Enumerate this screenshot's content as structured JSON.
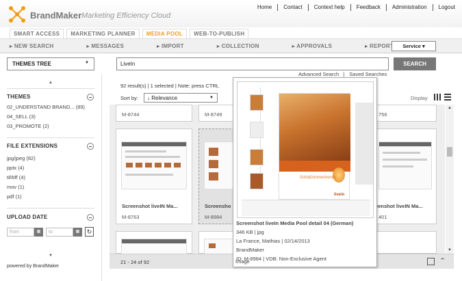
{
  "header": {
    "brand": "BrandMaker",
    "tagline": "Marketing Efficiency Cloud",
    "top_links": [
      "Home",
      "Contact",
      "Context help",
      "Feedback",
      "Administration",
      "Logout"
    ]
  },
  "module_tabs": [
    "SMART ACCESS",
    "MARKETING PLANNER",
    "MEDIA POOL",
    "WEB-TO-PUBLISH"
  ],
  "active_module": "MEDIA POOL",
  "subnav": [
    "NEW SEARCH",
    "MESSAGES",
    "IMPORT",
    "COLLECTION",
    "APPROVALS",
    "REPORTS"
  ],
  "service_label": "Service",
  "sidebar": {
    "tree_select": "THEMES TREE",
    "themes": {
      "title": "THEMES",
      "items": [
        "02_UNDERSTAND BRAND... (89)",
        "04_SELL (3)",
        "03_PROMOTE (2)"
      ]
    },
    "file_extensions": {
      "title": "FILE EXTENSIONS",
      "items": [
        "jpg/jpeg (82)",
        "pptx (4)",
        "tif/tiff (4)",
        "mov (1)",
        "pdf (1)"
      ]
    },
    "upload_date": {
      "title": "UPLOAD DATE",
      "from_placeholder": "from",
      "to_placeholder": "to"
    },
    "powered_by": "powered by BrandMaker"
  },
  "search": {
    "value": "LiveIn",
    "button": "SEARCH",
    "advanced_link": "Advanced Search",
    "saved_link": "Saved Searches"
  },
  "results": {
    "summary": "92 result(s) | 1 selected | Note: press CTRL",
    "sort_label": "Sort by:",
    "sort_value": "Relevance",
    "display_label": "Display",
    "top_row_ids": [
      "M-8744",
      "M-8749",
      "756"
    ],
    "cards": [
      {
        "name": "Screenshot liveIN Ma...",
        "id": "M-8763"
      },
      {
        "name": "Screensho",
        "id": "M-8984"
      },
      {
        "name": "creenshot liveIN Ma...",
        "id": "401"
      }
    ],
    "pager": "21 - 24 of 92"
  },
  "preview": {
    "title": "Screenshot liveIn Media Pool detail 04 (German)",
    "meta": "346 KB | jpg",
    "author": "La France, Mathias | 02/14/2013",
    "company": "BrandMaker",
    "id_line": "ID: M-8984 | VDB: Non-Exclusive Agent",
    "type": "Image",
    "image_caption": "Schlafzimmertrends",
    "image_brand": "livein"
  }
}
